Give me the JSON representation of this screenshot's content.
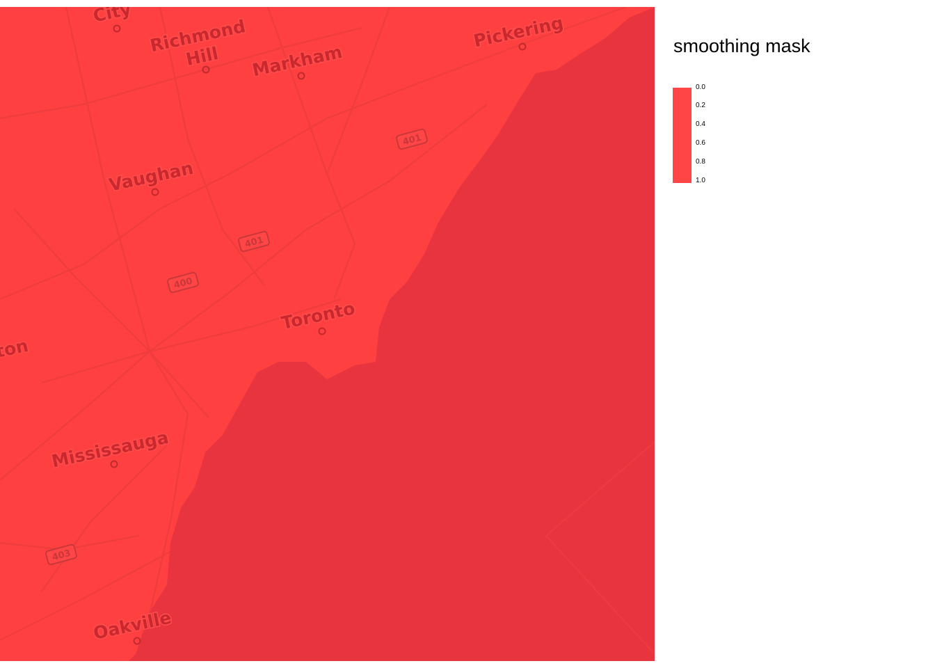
{
  "map": {
    "fill_color": "#ff4040",
    "lake_color": "#e8343f",
    "cities": [
      {
        "name": "City"
      },
      {
        "name": "Richmond\nHill"
      },
      {
        "name": "Markham"
      },
      {
        "name": "Pickering"
      },
      {
        "name": "Vaughan"
      },
      {
        "name": "Toronto"
      },
      {
        "name": "ton"
      },
      {
        "name": "Mississauga"
      },
      {
        "name": "Oakville"
      }
    ],
    "highways": [
      "401",
      "401",
      "400",
      "403"
    ]
  },
  "legend": {
    "title": "smoothing mask",
    "bar_color": "#ff4545",
    "ticks": [
      "0.0",
      "0.2",
      "0.4",
      "0.6",
      "0.8",
      "1.0"
    ]
  }
}
